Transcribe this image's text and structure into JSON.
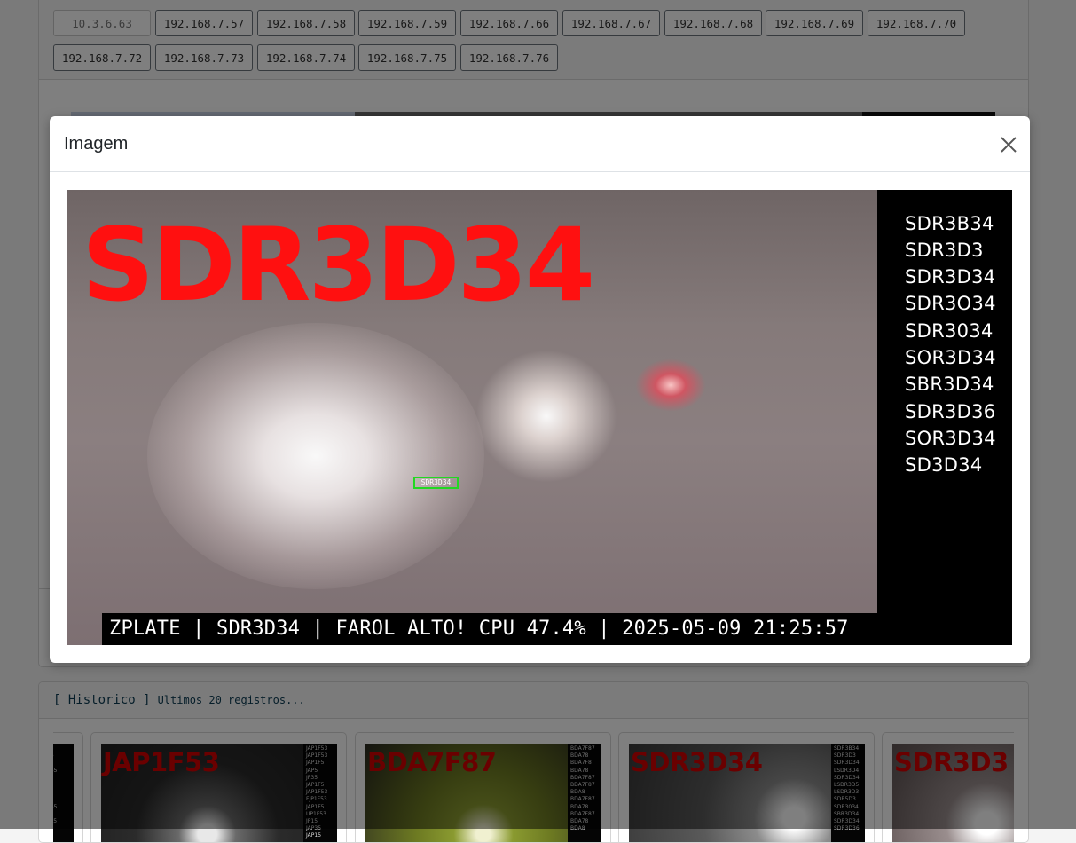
{
  "ip_buttons": {
    "row1": [
      "10.3.6.63",
      "192.168.7.57",
      "192.168.7.58",
      "192.168.7.59",
      "192.168.7.66",
      "192.168.7.67",
      "192.168.7.68",
      "192.168.7.69",
      "192.168.7.70"
    ],
    "row2": [
      "192.168.7.72",
      "192.168.7.73",
      "192.168.7.74",
      "192.168.7.75",
      "192.168.7.76"
    ]
  },
  "history": {
    "title": "[ Historico ]",
    "subtitle": "Ultimos 20 registros...",
    "thumbs": [
      {
        "plate": "JAP1F53",
        "candidates": [
          "JAP1F53",
          "JAP1F53",
          "JAP1F5",
          "JAP5",
          "JP35",
          "JAP1F5",
          "JAP1F53",
          "FJP1F53",
          "JAP1F5",
          "UP1F53",
          "JP15",
          "JAP35",
          "JAP15"
        ]
      },
      {
        "plate": "BDA7F87",
        "candidates": [
          "BDA7F87",
          "BDA78",
          "BDA7F8",
          "BDA78",
          "BDA7F87",
          "BDA7F87",
          "BDA8",
          "BDA7F87",
          "BDA78",
          "BDA7F87",
          "BDA78",
          "BDA8"
        ]
      },
      {
        "plate": "SDR3D34",
        "candidates": [
          "SDR3B34",
          "SDR3D3",
          "SDR3D34",
          "LSDR3D4",
          "SDR3D34",
          "LSDR3D5",
          "LSDR3D3",
          "SDR5D3",
          "SDR3034",
          "SBR3D34",
          "SDR3D34",
          "SDR3D36"
        ]
      },
      {
        "plate": "SDR3D3",
        "candidates": []
      }
    ]
  },
  "modal": {
    "title": "Imagem",
    "close_label": "×"
  },
  "camera": {
    "plate": "SDR3D34",
    "candidates": [
      "SDR3B34",
      "SDR3D3",
      "SDR3D34",
      "SDR3O34",
      "SDR3034",
      "SOR3D34",
      "SBR3D34",
      "SDR3D36",
      "SOR3D34",
      "SD3D34"
    ],
    "detection_label": "SDR3D34",
    "status": "ZPLATE | SDR3D34 | FAROL ALTO! CPU 47.4% | 2025-05-09 21:25:57"
  },
  "colors": {
    "plate_red": "#ff1010",
    "detect_green": "#22d822",
    "history_text": "#0b3b52"
  }
}
